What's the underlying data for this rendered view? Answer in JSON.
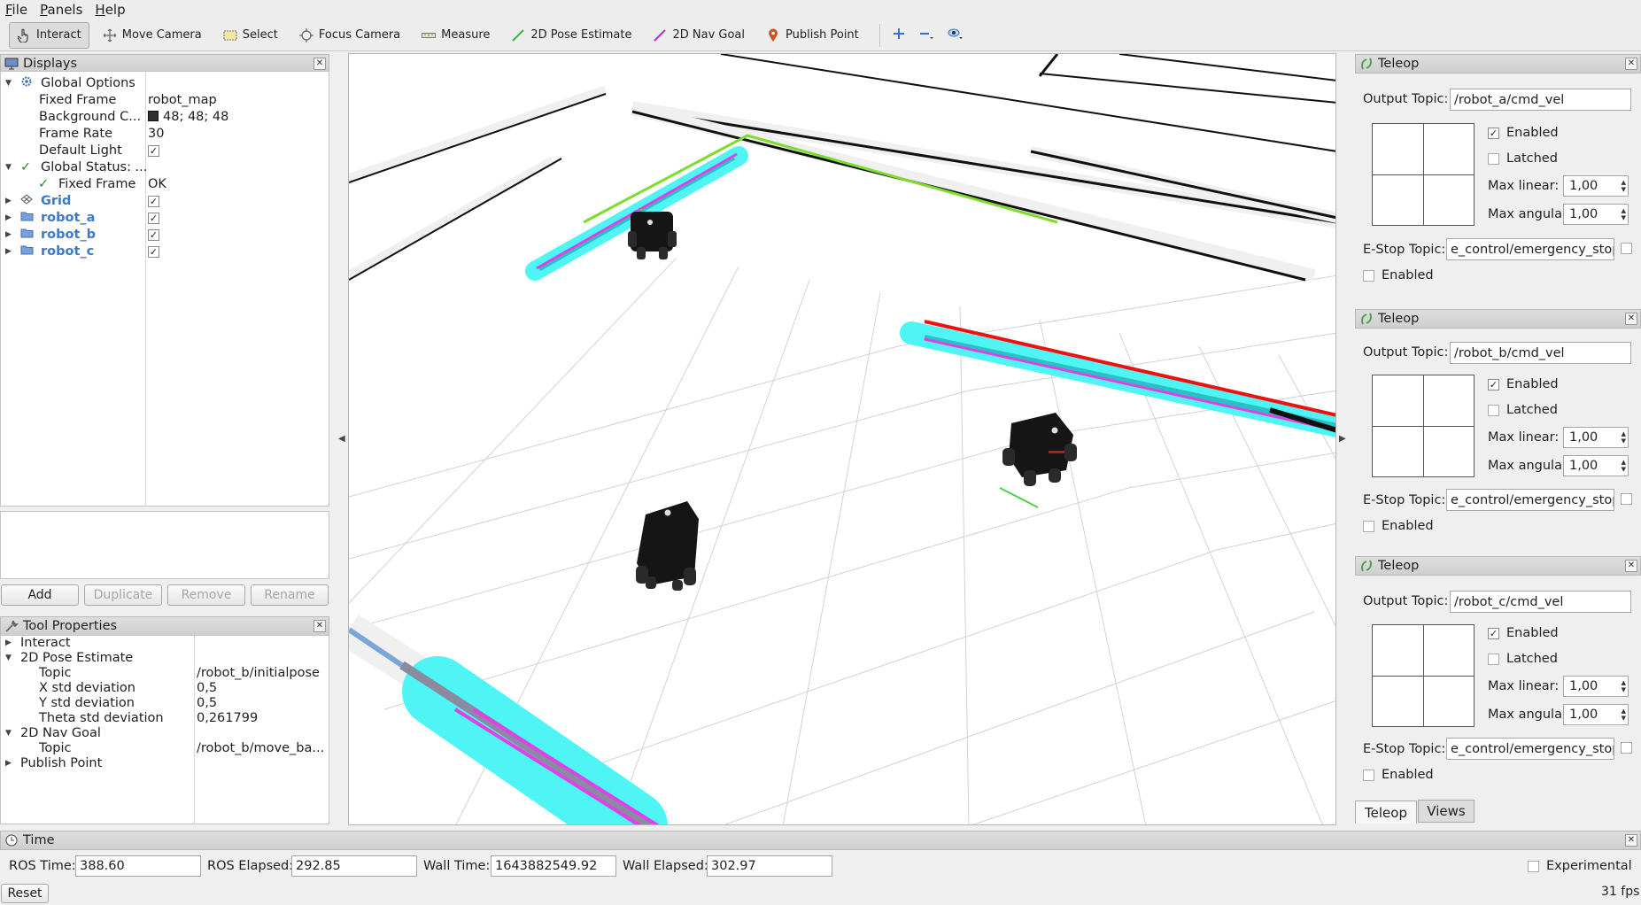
{
  "menu": [
    "File",
    "Panels",
    "Help"
  ],
  "toolbar": {
    "tools": [
      "Interact",
      "Move Camera",
      "Select",
      "Focus Camera",
      "Measure",
      "2D Pose Estimate",
      "2D Nav Goal",
      "Publish Point"
    ]
  },
  "displays": {
    "title": "Displays",
    "global_options": "Global Options",
    "fixed_frame_label": "Fixed Frame",
    "fixed_frame_value": "robot_map",
    "bg_color_label": "Background C...",
    "bg_color_value": "48; 48; 48",
    "frame_rate_label": "Frame Rate",
    "frame_rate_value": "30",
    "default_light_label": "Default Light",
    "global_status": "Global Status: ...",
    "status_fixed_frame": "Fixed Frame",
    "status_fixed_frame_value": "OK",
    "grid": "Grid",
    "robot_a": "robot_a",
    "robot_b": "robot_b",
    "robot_c": "robot_c"
  },
  "display_buttons": {
    "add": "Add",
    "duplicate": "Duplicate",
    "remove": "Remove",
    "rename": "Rename"
  },
  "tool_properties": {
    "title": "Tool Properties",
    "interact": "Interact",
    "pose_estimate": "2D Pose Estimate",
    "topic_label": "Topic",
    "pose_topic": "/robot_b/initialpose",
    "x_std_label": "X std deviation",
    "x_std": "0,5",
    "y_std_label": "Y std deviation",
    "y_std": "0,5",
    "theta_std_label": "Theta std deviation",
    "theta_std": "0,261799",
    "nav_goal": "2D Nav Goal",
    "nav_topic_label": "Topic",
    "nav_topic": "/robot_b/move_ba...",
    "publish_point": "Publish Point"
  },
  "teleop": [
    {
      "title": "Teleop",
      "output_topic_label": "Output Topic:",
      "output_topic": "/robot_a/cmd_vel",
      "enabled": "Enabled",
      "latched": "Latched",
      "max_linear_label": "Max linear:",
      "max_linear": "1,00",
      "max_angular_label": "Max angular:",
      "max_angular": "1,00",
      "estop_label": "E-Stop Topic:",
      "estop_topic": "e_control/emergency_stop",
      "estop_enabled": "Enabled"
    },
    {
      "title": "Teleop",
      "output_topic_label": "Output Topic:",
      "output_topic": "/robot_b/cmd_vel",
      "enabled": "Enabled",
      "latched": "Latched",
      "max_linear_label": "Max linear:",
      "max_linear": "1,00",
      "max_angular_label": "Max angular:",
      "max_angular": "1,00",
      "estop_label": "E-Stop Topic:",
      "estop_topic": "e_control/emergency_stop",
      "estop_enabled": "Enabled"
    },
    {
      "title": "Teleop",
      "output_topic_label": "Output Topic:",
      "output_topic": "/robot_c/cmd_vel",
      "enabled": "Enabled",
      "latched": "Latched",
      "max_linear_label": "Max linear:",
      "max_linear": "1,00",
      "max_angular_label": "Max angular:",
      "max_angular": "1,00",
      "estop_label": "E-Stop Topic:",
      "estop_topic": "e_control/emergency_stop",
      "estop_enabled": "Enabled"
    }
  ],
  "right_tabs": [
    "Teleop",
    "Views"
  ],
  "time": {
    "title": "Time",
    "ros_time_label": "ROS Time:",
    "ros_time": "388.60",
    "ros_elapsed_label": "ROS Elapsed:",
    "ros_elapsed": "292.85",
    "wall_time_label": "Wall Time:",
    "wall_time": "1643882549.92",
    "wall_elapsed_label": "Wall Elapsed:",
    "wall_elapsed": "302.97",
    "experimental": "Experimental",
    "reset": "Reset",
    "fps": "31 fps"
  },
  "colors": {
    "costmap_cyan": "#4ff5f5",
    "path_magenta": "#e040e8",
    "plan_green": "#7ddc2e",
    "laser_red": "#ee1111",
    "wall_black": "#111111",
    "robot_body": "#151515"
  }
}
